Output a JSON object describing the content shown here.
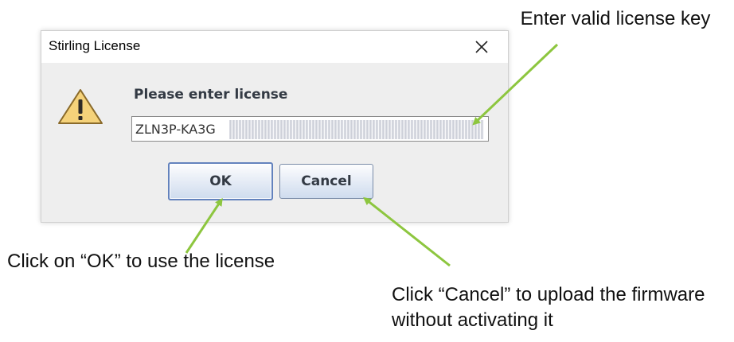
{
  "dialog": {
    "title": "Stirling License",
    "prompt": "Please enter license",
    "license_input_value": "ZLN3P-KA3G",
    "ok_label": "OK",
    "cancel_label": "Cancel",
    "icons": {
      "close": "close-icon",
      "warning": "warning-icon"
    }
  },
  "annotations": {
    "license_key": "Enter valid license key",
    "ok": "Click on “OK” to use the license",
    "cancel": "Click “Cancel” to upload the firmware without activating it"
  },
  "colors": {
    "arrow": "#8dc63f",
    "warning_fill": "#f5d27a",
    "button_border": "#6382bd"
  }
}
